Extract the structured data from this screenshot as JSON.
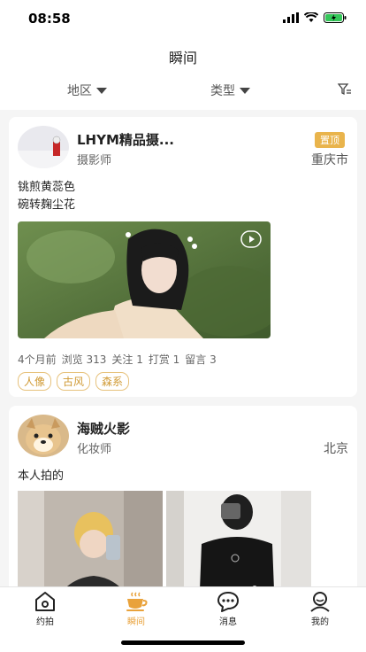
{
  "status": {
    "time": "08:58"
  },
  "nav": {
    "title": "瞬间"
  },
  "filters": {
    "region": "地区",
    "type": "类型"
  },
  "posts": [
    {
      "name": "LHYM精品摄...",
      "role": "摄影师",
      "city": "重庆市",
      "pinned": "置顶",
      "lines": [
        "铫煎黄蕊色",
        "碗转麹尘花"
      ],
      "meta": [
        "4个月前",
        "浏览 313",
        "关注 1",
        "打赏 1",
        "留言 3"
      ],
      "tags": [
        "人像",
        "古风",
        "森系"
      ]
    },
    {
      "name": "海贼火影",
      "role": "化妆师",
      "city": "北京",
      "text": "本人拍的"
    }
  ],
  "tabs": [
    {
      "label": "约拍",
      "icon": "home-icon"
    },
    {
      "label": "瞬间",
      "icon": "coffee-icon",
      "active": true
    },
    {
      "label": "消息",
      "icon": "message-icon"
    },
    {
      "label": "我的",
      "icon": "profile-icon"
    }
  ],
  "colors": {
    "accent": "#e9a23b",
    "tag": "#d09a34",
    "pin": "#e9b44c"
  }
}
